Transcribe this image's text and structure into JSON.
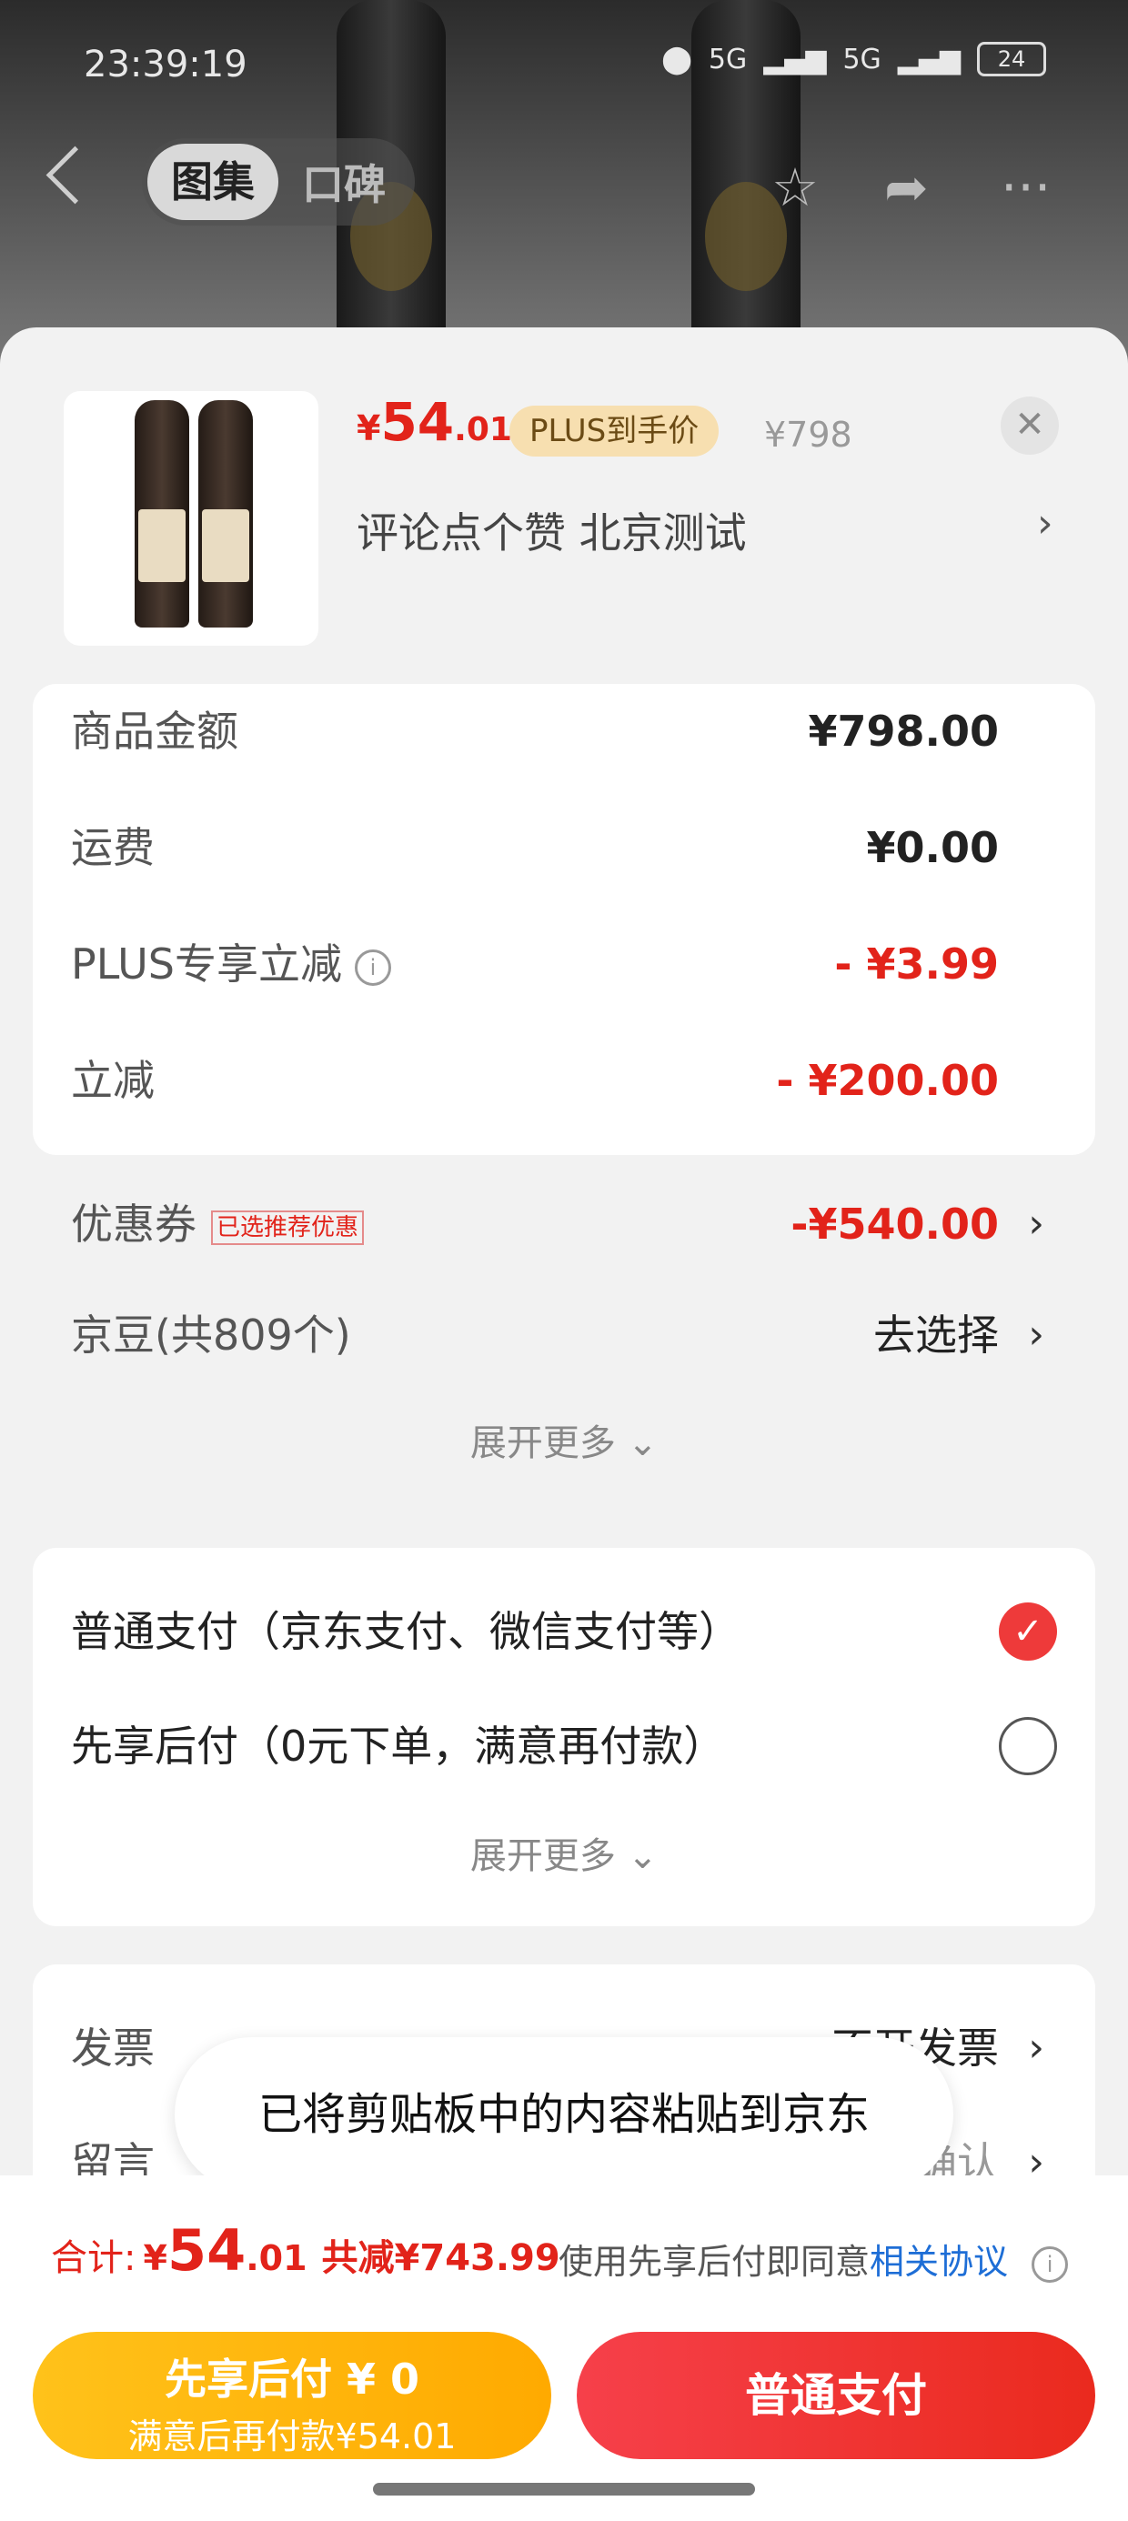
{
  "status_bar": {
    "time": "23:39:19",
    "network": "5G",
    "battery": "24"
  },
  "top_nav": {
    "tabs": [
      "图集",
      "口碑"
    ],
    "active_tab": 0
  },
  "product": {
    "price_currency": "¥",
    "price_int": "54",
    "price_dec": ".01",
    "plus_label": "PLUS到手价",
    "original_price": "¥798",
    "desc": "评论点个赞  北京测试",
    "close_symbol": "✕"
  },
  "summary": {
    "rows": [
      {
        "label": "商品金额",
        "value": "¥798.00"
      },
      {
        "label": "运费",
        "value": "¥0.00"
      },
      {
        "label": "PLUS专享立减",
        "value": "- ¥3.99"
      },
      {
        "label": "立减",
        "value": "- ¥200.00"
      },
      {
        "label": "优惠券",
        "tag": "已选推荐优惠",
        "value": "-¥540.00"
      },
      {
        "label": "京豆(共809个)",
        "value": "去选择"
      }
    ],
    "more": "展开更多"
  },
  "payment": {
    "options": [
      {
        "label": "普通支付（京东支付、微信支付等）",
        "selected": true
      },
      {
        "label": "先享后付（0元下单，满意再付款）",
        "selected": false
      }
    ],
    "more": "展开更多"
  },
  "extra": {
    "rows": [
      {
        "label": "发票",
        "value": "不开发票"
      },
      {
        "label": "留言",
        "value": "确认"
      }
    ]
  },
  "toast": "已将剪贴板中的内容粘贴到京东",
  "footer": {
    "total_label": "合计:",
    "currency": "¥",
    "total_int": "54",
    "total_dec": ".01",
    "saved": "共减¥743.99",
    "agree_prefix": "使用先享后付即同意",
    "agree_link": "相关协议",
    "btn_later_line1": "先享后付 ¥ 0",
    "btn_later_line2": "满意后再付款¥54.01",
    "btn_pay": "普通支付"
  },
  "colors": {
    "accent": "#e2231a",
    "gold": "#ffb400",
    "plus_bg": "#f7dfb0"
  }
}
